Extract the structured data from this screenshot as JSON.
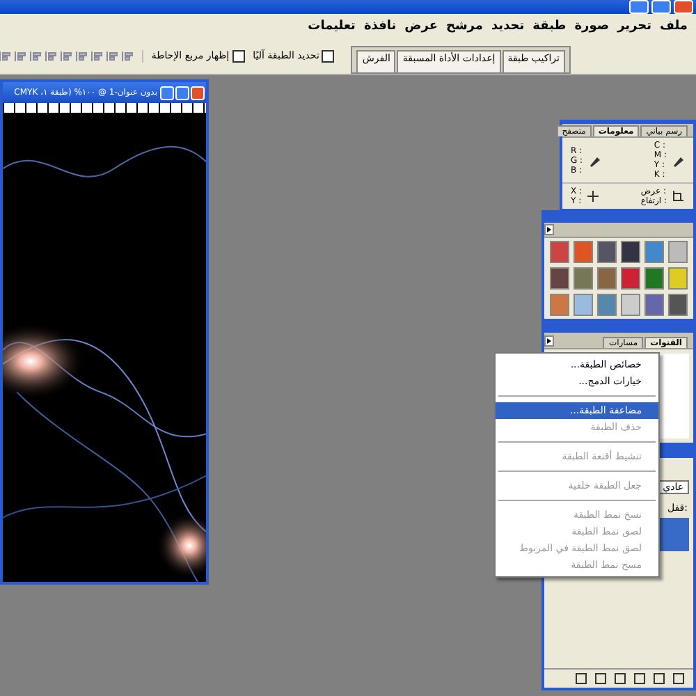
{
  "menu_bar": [
    "ملف",
    "تحرير",
    "صورة",
    "طبقة",
    "تحديد",
    "مرشح",
    "عرض",
    "نافذة",
    "تعليمات"
  ],
  "palette_well_tabs": [
    "تراكيب طبقة",
    "إعدادات الأداة المسبقة",
    "الفرش"
  ],
  "options_bar": {
    "checkboxes": [
      {
        "label": "تحديد الطبقة آليًا",
        "checked": false
      },
      {
        "label": "إظهار مربع الإحاطة",
        "checked": false
      }
    ]
  },
  "document": {
    "title": "بدون عنوان-1 @ ١٠٠% (طبقة ١، CMYK"
  },
  "info_panel": {
    "tabs": [
      {
        "label": "رسم بياني",
        "selected": false
      },
      {
        "label": "معلومات",
        "selected": true
      },
      {
        "label": "متصفح",
        "selected": false
      }
    ],
    "cmyk": [
      "C :",
      "M :",
      "Y :",
      "K :"
    ],
    "rgb": [
      "R :",
      "G :",
      "B :"
    ],
    "size": [
      "عرض :",
      "ارتفاع :"
    ],
    "xy": [
      "X :",
      "Y :"
    ]
  },
  "layers_panel": {
    "tabs": [
      {
        "label": "القنوات",
        "selected": true
      },
      {
        "label": "مسارات",
        "selected": false
      }
    ]
  },
  "lower_panel": {
    "blend_mode": "عادي",
    "lock_label": "قفل:"
  },
  "context_menu": [
    {
      "kind": "item",
      "label": "خصائص الطبقة...",
      "disabled": false,
      "selected": false
    },
    {
      "kind": "item",
      "label": "خيارات الدمج...",
      "disabled": false,
      "selected": false
    },
    {
      "kind": "separator"
    },
    {
      "kind": "item",
      "label": "مضاعفة الطبقة...",
      "disabled": false,
      "selected": true
    },
    {
      "kind": "item",
      "label": "حذف الطبقة",
      "disabled": true,
      "selected": false
    },
    {
      "kind": "separator"
    },
    {
      "kind": "item",
      "label": "تنشيط أقنعة الطبقة",
      "disabled": true,
      "selected": false
    },
    {
      "kind": "separator"
    },
    {
      "kind": "item",
      "label": "جعل الطبقة خلفية",
      "disabled": true,
      "selected": false
    },
    {
      "kind": "separator"
    },
    {
      "kind": "item",
      "label": "نسخ نمط الطبقة",
      "disabled": true,
      "selected": false
    },
    {
      "kind": "item",
      "label": "لصق نمط الطبقة",
      "disabled": true,
      "selected": false
    },
    {
      "kind": "item",
      "label": "لصق نمط الطبقة في المربوط",
      "disabled": true,
      "selected": false
    },
    {
      "kind": "item",
      "label": "مسح نمط الطبقة",
      "disabled": true,
      "selected": false
    }
  ]
}
